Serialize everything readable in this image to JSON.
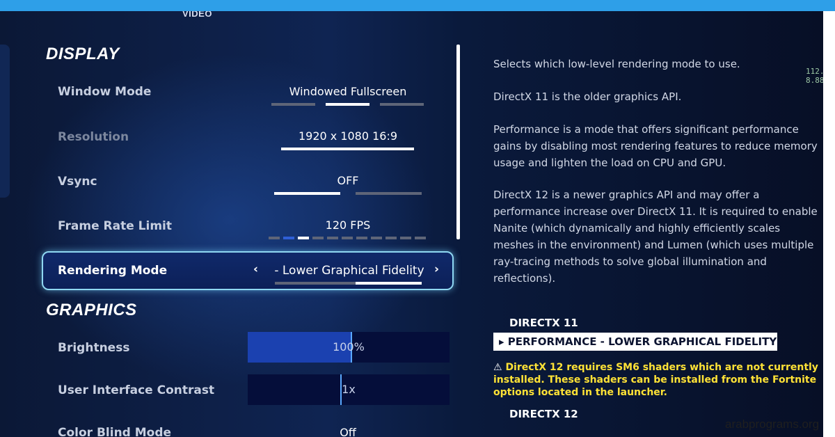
{
  "tab": "VIDEO",
  "display": {
    "section_title": "DISPLAY",
    "window_mode": {
      "label": "Window Mode",
      "value": "Windowed Fullscreen"
    },
    "resolution": {
      "label": "Resolution",
      "value": "1920 x 1080 16:9"
    },
    "vsync": {
      "label": "Vsync",
      "value": "OFF"
    },
    "frame_rate": {
      "label": "Frame Rate Limit",
      "value": "120 FPS"
    },
    "rendering_mode": {
      "label": "Rendering Mode",
      "value": "- Lower Graphical Fidelity",
      "prev": "‹",
      "next": "›"
    }
  },
  "graphics": {
    "section_title": "GRAPHICS",
    "brightness": {
      "label": "Brightness",
      "value": "100%",
      "level": 0.51
    },
    "ui_contrast": {
      "label": "User Interface Contrast",
      "value": "1x",
      "level": 0.46
    },
    "color_blind": {
      "label": "Color Blind Mode",
      "value": "Off"
    }
  },
  "description": {
    "p1": "Selects which low-level rendering mode to use.",
    "p2": "DirectX 11 is the older graphics API.",
    "p3": "Performance is a mode that offers significant performance gains by disabling most rendering features to reduce memory usage and lighten the load on CPU and GPU.",
    "p4": "DirectX 12 is a newer graphics API and may offer a performance increase over DirectX 11. It is required to enable Nanite (which dynamically and highly efficiently scales meshes in the environment) and Lumen (which uses multiple ray-tracing methods to solve global illumination and reflections)."
  },
  "options": {
    "dx11": "DIRECTX 11",
    "performance": "PERFORMANCE - LOWER GRAPHICAL FIDELITY",
    "warning": "DirectX 12 requires SM6 shaders which are not currently installed. These shaders can be installed from the Fortnite options located in the launcher.",
    "dx12": "DIRECTX 12"
  },
  "overlay": {
    "line1": "112.",
    "line2": "8.88"
  },
  "watermark": "arabprograms.org"
}
